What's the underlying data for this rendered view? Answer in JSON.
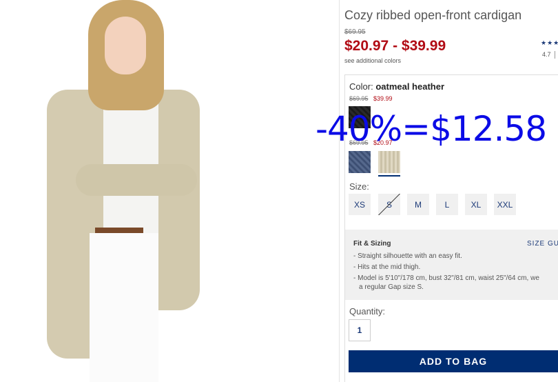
{
  "product": {
    "title": "Cozy ribbed open-front cardigan",
    "original_price": "$69.95",
    "price_range": "$20.97 - $39.99",
    "additional_colors_link": "see additional colors",
    "rating_stars": "★★★",
    "rating_value": "4.7"
  },
  "color": {
    "label": "Color:",
    "selected": "oatmeal heather",
    "groups": [
      {
        "old_price": "$69.95",
        "new_price": "$39.99",
        "swatches": [
          "black"
        ]
      },
      {
        "old_price": "$69.95",
        "new_price": "$20.97",
        "swatches": [
          "blue",
          "oatmeal heather"
        ]
      }
    ]
  },
  "overlay_text": "-40%=$12.58",
  "size": {
    "label": "Size:",
    "options": [
      "XS",
      "S",
      "M",
      "L",
      "XL",
      "XXL"
    ],
    "unavailable": [
      "S"
    ]
  },
  "fit": {
    "title": "Fit & Sizing",
    "size_guide": "SIZE GU",
    "bullets": [
      "Straight silhouette with an easy fit.",
      "Hits at the mid thigh.",
      "Model is 5'10\"/178 cm, bust 32\"/81 cm, waist 25\"/64 cm, we",
      "a regular Gap size S."
    ]
  },
  "quantity": {
    "label": "Quantity:",
    "value": "1"
  },
  "add_to_bag": "ADD TO BAG",
  "colors": {
    "price_red": "#b10b14",
    "navy": "#002d72",
    "overlay_blue": "#0b0be6"
  }
}
